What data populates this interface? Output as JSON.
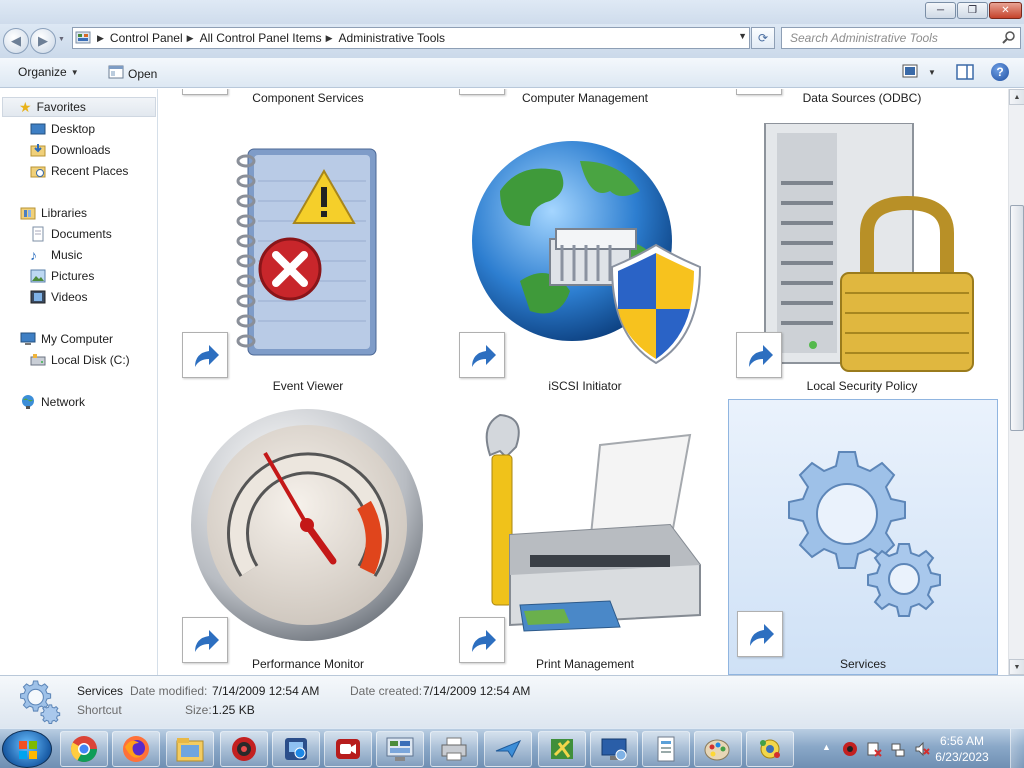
{
  "window": {
    "min_glyph": "─",
    "max_glyph": "❐",
    "close_glyph": "✕"
  },
  "address": {
    "crumbs": [
      "Control Panel",
      "All Control Panel Items",
      "Administrative Tools"
    ],
    "search_placeholder": "Search Administrative Tools"
  },
  "toolbar": {
    "organize_label": "Organize",
    "open_label": "Open"
  },
  "nav": {
    "favorites": {
      "label": "Favorites",
      "items": [
        "Desktop",
        "Downloads",
        "Recent Places"
      ]
    },
    "libraries": {
      "label": "Libraries",
      "items": [
        "Documents",
        "Music",
        "Pictures",
        "Videos"
      ]
    },
    "computer": {
      "label": "My Computer",
      "items": [
        "Local Disk (C:)"
      ]
    },
    "network": {
      "label": "Network"
    }
  },
  "tiles": [
    {
      "label": "Component Services",
      "icon": "component-services-icon"
    },
    {
      "label": "Computer Management",
      "icon": "computer-management-icon"
    },
    {
      "label": "Data Sources (ODBC)",
      "icon": "odbc-icon"
    },
    {
      "label": "Event Viewer",
      "icon": "event-viewer-icon"
    },
    {
      "label": "iSCSI Initiator",
      "icon": "iscsi-initiator-icon"
    },
    {
      "label": "Local Security Policy",
      "icon": "local-security-policy-icon"
    },
    {
      "label": "Performance Monitor",
      "icon": "performance-monitor-icon"
    },
    {
      "label": "Print Management",
      "icon": "print-management-icon"
    },
    {
      "label": "Services",
      "icon": "services-icon",
      "selected": true
    }
  ],
  "details": {
    "name": "Services",
    "type": "Shortcut",
    "date_modified_label": "Date modified:",
    "date_modified": "7/14/2009 12:54 AM",
    "date_created_label": "Date created:",
    "date_created": "7/14/2009 12:54 AM",
    "size_label": "Size:",
    "size": "1.25 KB"
  },
  "taskbar": {
    "time": "6:56 AM",
    "date": "6/23/2023",
    "apps": [
      "chrome-icon",
      "firefox-icon",
      "file-explorer-icon",
      "recorder-icon",
      "screenshot-tool-icon",
      "video-recorder-icon",
      "control-panel-icon",
      "printer-icon",
      "network-tool-icon",
      "app-icon",
      "remote-desktop-icon",
      "document-icon",
      "paint-icon",
      "settings-tool-icon"
    ]
  },
  "colors": {
    "selection_bg": "#cfe1f6",
    "taskbar": "#8aa8c8"
  }
}
